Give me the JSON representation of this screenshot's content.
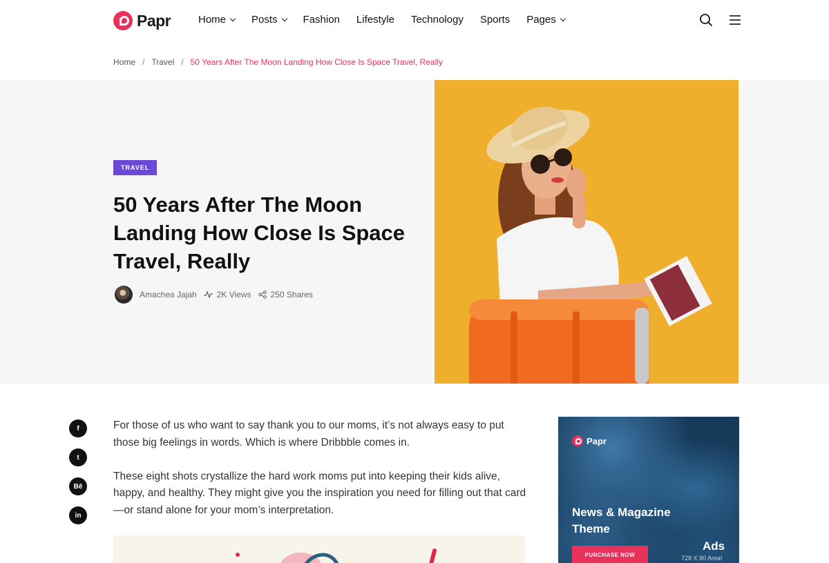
{
  "brand": {
    "name": "Papr",
    "accent": "#e8315b"
  },
  "nav": {
    "items": [
      {
        "label": "Home",
        "dropdown": true
      },
      {
        "label": "Posts",
        "dropdown": true
      },
      {
        "label": "Fashion",
        "dropdown": false
      },
      {
        "label": "Lifestyle",
        "dropdown": false
      },
      {
        "label": "Technology",
        "dropdown": false
      },
      {
        "label": "Sports",
        "dropdown": false
      },
      {
        "label": "Pages",
        "dropdown": true
      }
    ],
    "icons": [
      "search-icon",
      "menu-icon"
    ]
  },
  "breadcrumb": {
    "home": "Home",
    "separator": "/",
    "category": "Travel",
    "current": "50 Years After The Moon Landing How Close Is Space Travel, Really"
  },
  "hero": {
    "category_badge": "TRAVEL",
    "badge_color": "#6a49d6",
    "title": "50 Years After The Moon Landing How Close Is Space Travel, Really",
    "author": "Amachea Jajah",
    "views": "2K Views",
    "shares": "250 Shares",
    "image_background": "#efae2b"
  },
  "social": [
    "f",
    "t",
    "Bē",
    "in"
  ],
  "article": {
    "paragraphs": [
      "For those of us who want to say thank you to our moms, it’s not always easy to put those big feelings in words. Which is where Dribbble comes in.",
      "These eight shots crystallize the hard work moms put into keeping their kids alive, happy, and healthy. They might give you the inspiration you need for filling out that card—or stand alone for your mom’s interpretation."
    ]
  },
  "ad": {
    "logo": "Papr",
    "title": "News & Magazine Theme",
    "label": "Ads",
    "size": "728 X 90 Area!",
    "button": "PURCHASE NOW"
  }
}
